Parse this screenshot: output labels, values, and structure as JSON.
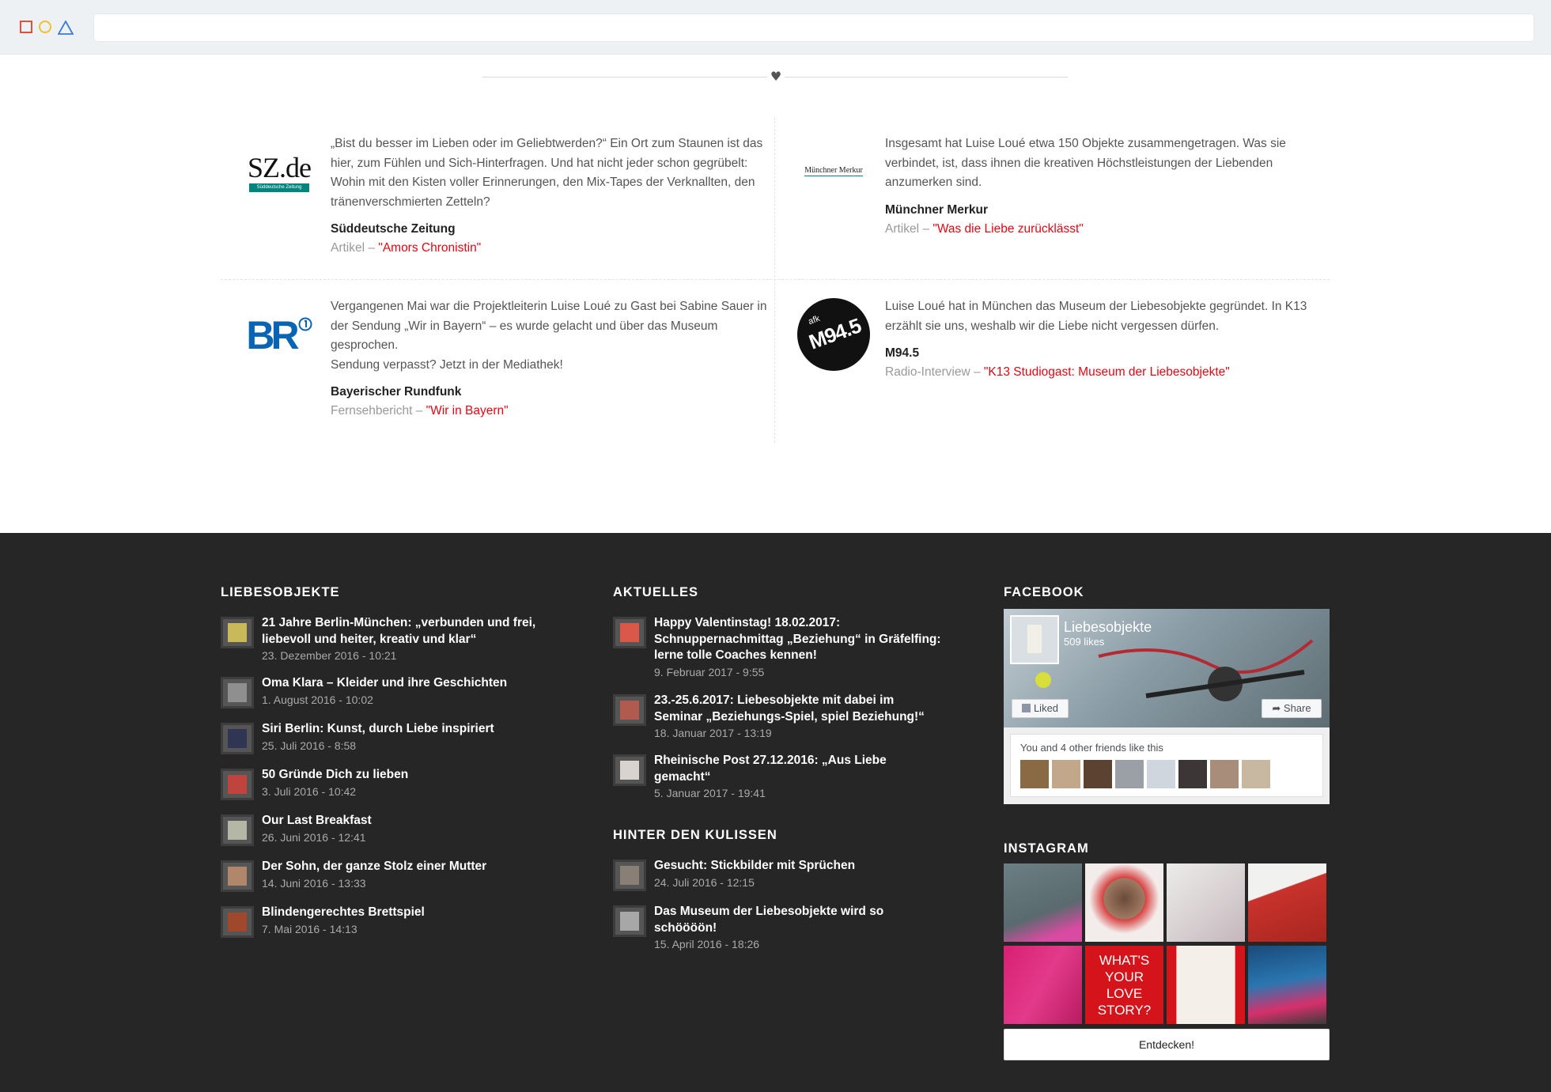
{
  "press": {
    "items": [
      {
        "logo_text": "SZ.de",
        "logo_sub": "Süddeutsche Zeitung",
        "quote": "„Bist du besser im Lieben oder im Geliebtwerden?“ Ein Ort zum Staunen ist das hier, zum Fühlen und Sich-Hinterfragen. Und hat nicht jeder schon gegrübelt: Wohin mit den Kisten voller Erinnerungen, den Mix-Tapes der Verknallten, den tränenverschmierten Zetteln?",
        "source": "Süddeutsche Zeitung",
        "type": "Artikel",
        "link": "\"Amors Chronistin\""
      },
      {
        "logo_text": "Münchner Merkur",
        "quote": "Insgesamt hat Luise Loué etwa 150 Objekte zusammengetragen. Was sie verbindet, ist, dass ihnen die kreativen Höchstleistungen der Liebenden anzumerken sind.",
        "source": "Münchner Merkur",
        "type": "Artikel",
        "link": "\"Was die Liebe zurücklässt\""
      },
      {
        "logo_text": "BR",
        "quote": "Vergangenen Mai war die Projektleiterin Luise Loué zu Gast bei Sabine Sauer in der Sendung „Wir in Bayern“ – es wurde gelacht und über das Museum gesprochen.",
        "quote2": "Sendung verpasst? Jetzt in der Mediathek!",
        "source": "Bayerischer Rundfunk",
        "type": "Fernsehbericht",
        "link": "\"Wir in Bayern\""
      },
      {
        "logo_text": "M94.5",
        "logo_sub": "afk",
        "quote": "Luise Loué hat in München das Museum der Liebesobjekte gegründet. In K13 erzählt sie uns, weshalb wir die Liebe nicht vergessen dürfen.",
        "source": "M94.5",
        "type": "Radio-Interview",
        "link": "\"K13 Studiogast: Museum der Liebesobjekte\""
      }
    ],
    "separator": " – ",
    "heart_icon": "♥"
  },
  "footer": {
    "liebesobjekte": {
      "heading": "LIEBESOBJEKTE",
      "items": [
        {
          "title": "21 Jahre Berlin-München: „verbunden und frei, liebevoll und heiter, kreativ und klar“",
          "date": "23. Dezember 2016 - 10:21"
        },
        {
          "title": "Oma Klara – Kleider und ihre Geschichten",
          "date": "1. August 2016 - 10:02"
        },
        {
          "title": "Siri Berlin: Kunst, durch Liebe inspiriert",
          "date": "25. Juli 2016 - 8:58"
        },
        {
          "title": "50 Gründe Dich zu lieben",
          "date": "3. Juli 2016 - 10:42"
        },
        {
          "title": "Our Last Breakfast",
          "date": "26. Juni 2016 - 12:41"
        },
        {
          "title": "Der Sohn, der ganze Stolz einer Mutter",
          "date": "14. Juni 2016 - 13:33"
        },
        {
          "title": "Blindengerechtes Brettspiel",
          "date": "7. Mai 2016 - 14:13"
        }
      ]
    },
    "aktuelles": {
      "heading": "AKTUELLES",
      "items": [
        {
          "title": "Happy Valentinstag! 18.02.2017: Schnuppernachmittag „Beziehung“ in Gräfelfing: lerne tolle Coaches kennen!",
          "date": "9. Februar 2017 - 9:55"
        },
        {
          "title": "23.-25.6.2017: Liebesobjekte mit dabei im Seminar „Beziehungs-Spiel, spiel Beziehung!“",
          "date": "18. Januar 2017 - 13:19"
        },
        {
          "title": "Rheinische Post 27.12.2016: „Aus Liebe gemacht“",
          "date": "5. Januar 2017 - 19:41"
        }
      ]
    },
    "hinter": {
      "heading": "HINTER DEN KULISSEN",
      "items": [
        {
          "title": "Gesucht: Stickbilder mit Sprüchen",
          "date": "24. Juli 2016 - 12:15"
        },
        {
          "title": "Das Museum der Liebesobjekte wird so schöööön!",
          "date": "15. April 2016 - 18:26"
        }
      ]
    },
    "facebook": {
      "heading": "FACEBOOK",
      "page_name": "Liebesobjekte",
      "likes": "509 likes",
      "liked_label": "Liked",
      "share_label": "Share",
      "friends_text": "You and 4 other friends like this"
    },
    "instagram": {
      "heading": "INSTAGRAM",
      "love_text": "WHAT'S YOUR LOVE STORY?",
      "button": "Entdecken!"
    }
  },
  "colors": {
    "accent": "#e30613",
    "footer_bg": "#262626",
    "chrome_bg": "#eef1f3"
  }
}
